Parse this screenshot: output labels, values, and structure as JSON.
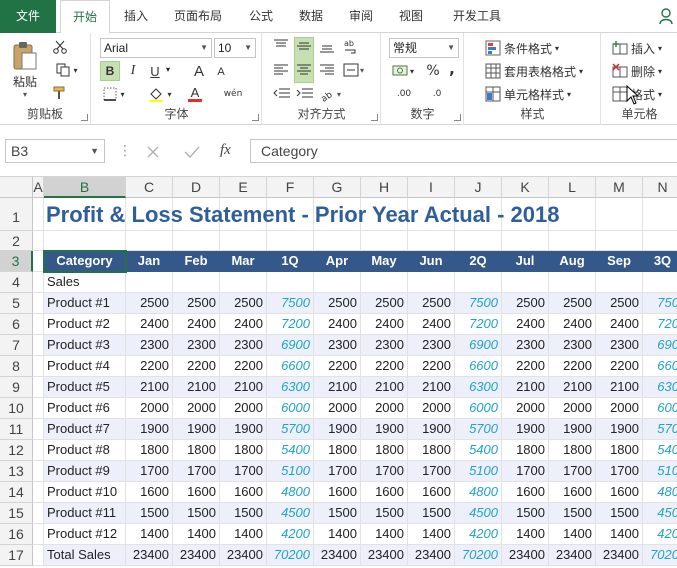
{
  "tabs": [
    {
      "label": "文件"
    },
    {
      "label": "开始"
    },
    {
      "label": "插入"
    },
    {
      "label": "页面布局"
    },
    {
      "label": "公式"
    },
    {
      "label": "数据"
    },
    {
      "label": "审阅"
    },
    {
      "label": "视图"
    },
    {
      "label": "开发工具"
    }
  ],
  "ribbon": {
    "clipboard": {
      "label": "剪贴板",
      "paste": "粘贴"
    },
    "font": {
      "label": "字体",
      "name": "Arial",
      "size": "10",
      "bold": "B",
      "italic": "I",
      "underline": "U",
      "grow": "A",
      "shrink": "A",
      "color_a": "A",
      "phonetic": "wén"
    },
    "alignment": {
      "label": "对齐方式"
    },
    "number": {
      "label": "数字",
      "format": "常规",
      "percent": "%",
      "comma": ",",
      "dec_inc": ".00",
      "dec_dec": ".0"
    },
    "styles": {
      "label": "样式",
      "conditional": "条件格式",
      "table": "套用表格格式",
      "cell_styles": "单元格样式"
    },
    "cells": {
      "label": "单元格",
      "insert": "插入",
      "delete": "删除",
      "format": "格式"
    }
  },
  "formula_bar": {
    "name_box": "B3",
    "content": "Category",
    "fx": "fx"
  },
  "columns": [
    "A",
    "B",
    "C",
    "D",
    "E",
    "F",
    "G",
    "H",
    "I",
    "J",
    "K",
    "L",
    "M",
    "N"
  ],
  "rows": [
    "1",
    "2",
    "3",
    "4",
    "5",
    "6",
    "7",
    "8",
    "9",
    "10",
    "11",
    "12",
    "13",
    "14",
    "15",
    "16",
    "17"
  ],
  "sheet": {
    "title": "Profit & Loss Statement - Prior Year Actual - 2018",
    "headers": [
      "Category",
      "Jan",
      "Feb",
      "Mar",
      "1Q",
      "Apr",
      "May",
      "Jun",
      "2Q",
      "Jul",
      "Aug",
      "Sep",
      "3Q"
    ],
    "section": "Sales",
    "data": [
      [
        "Product #1",
        "2500",
        "2500",
        "2500",
        "7500",
        "2500",
        "2500",
        "2500",
        "7500",
        "2500",
        "2500",
        "2500",
        "750"
      ],
      [
        "Product #2",
        "2400",
        "2400",
        "2400",
        "7200",
        "2400",
        "2400",
        "2400",
        "7200",
        "2400",
        "2400",
        "2400",
        "720"
      ],
      [
        "Product #3",
        "2300",
        "2300",
        "2300",
        "6900",
        "2300",
        "2300",
        "2300",
        "6900",
        "2300",
        "2300",
        "2300",
        "690"
      ],
      [
        "Product #4",
        "2200",
        "2200",
        "2200",
        "6600",
        "2200",
        "2200",
        "2200",
        "6600",
        "2200",
        "2200",
        "2200",
        "660"
      ],
      [
        "Product #5",
        "2100",
        "2100",
        "2100",
        "6300",
        "2100",
        "2100",
        "2100",
        "6300",
        "2100",
        "2100",
        "2100",
        "630"
      ],
      [
        "Product #6",
        "2000",
        "2000",
        "2000",
        "6000",
        "2000",
        "2000",
        "2000",
        "6000",
        "2000",
        "2000",
        "2000",
        "600"
      ],
      [
        "Product #7",
        "1900",
        "1900",
        "1900",
        "5700",
        "1900",
        "1900",
        "1900",
        "5700",
        "1900",
        "1900",
        "1900",
        "570"
      ],
      [
        "Product #8",
        "1800",
        "1800",
        "1800",
        "5400",
        "1800",
        "1800",
        "1800",
        "5400",
        "1800",
        "1800",
        "1800",
        "540"
      ],
      [
        "Product #9",
        "1700",
        "1700",
        "1700",
        "5100",
        "1700",
        "1700",
        "1700",
        "5100",
        "1700",
        "1700",
        "1700",
        "510"
      ],
      [
        "Product #10",
        "1600",
        "1600",
        "1600",
        "4800",
        "1600",
        "1600",
        "1600",
        "4800",
        "1600",
        "1600",
        "1600",
        "480"
      ],
      [
        "Product #11",
        "1500",
        "1500",
        "1500",
        "4500",
        "1500",
        "1500",
        "1500",
        "4500",
        "1500",
        "1500",
        "1500",
        "450"
      ],
      [
        "Product #12",
        "1400",
        "1400",
        "1400",
        "4200",
        "1400",
        "1400",
        "1400",
        "4200",
        "1400",
        "1400",
        "1400",
        "420"
      ],
      [
        "Total Sales",
        "23400",
        "23400",
        "23400",
        "70200",
        "23400",
        "23400",
        "23400",
        "70200",
        "23400",
        "23400",
        "23400",
        "7020"
      ]
    ]
  },
  "colors": {
    "accent": "#217346",
    "header_fill": "#35588a",
    "title": "#2f5f9b",
    "quarter": "#1fa3c9",
    "band": "#edf0fb"
  }
}
